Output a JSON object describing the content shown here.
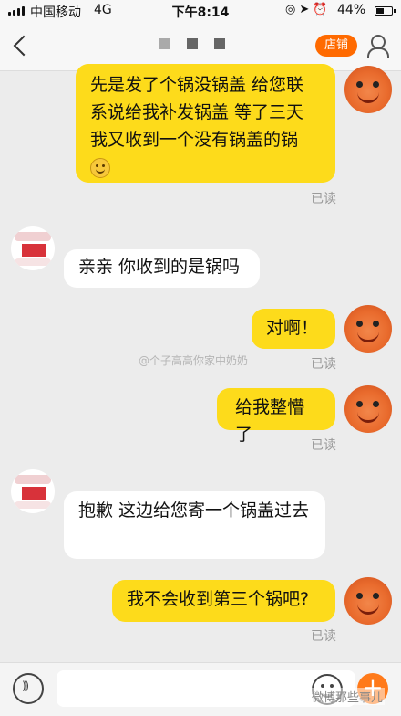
{
  "status": {
    "carrier": "中国移动",
    "network": "4G",
    "time": "下午8:14",
    "battery": "44%"
  },
  "nav": {
    "shop_label": "店铺"
  },
  "messages": [
    {
      "side": "out",
      "text": "先是发了个锅没锅盖 给您联系说给我补发锅盖 等了三天我又收到一个没有锅盖的锅",
      "read": "已读"
    },
    {
      "side": "in",
      "text": "亲亲 你收到的是锅吗"
    },
    {
      "side": "out",
      "text": "对啊！",
      "read": "已读"
    },
    {
      "side": "out",
      "text": "给我整懵了",
      "read": "已读"
    },
    {
      "side": "in",
      "text": "抱歉 这边给您寄一个锅盖过去"
    },
    {
      "side": "out",
      "text": "我不会收到第三个锅吧?",
      "read": "已读"
    }
  ],
  "watermark": "@个子高高你家中奶奶",
  "footer_watermark": "微博那些事儿",
  "colors": {
    "accent": "#ff6a00",
    "out_bubble": "#fddb1b",
    "in_bubble": "#ffffff"
  }
}
